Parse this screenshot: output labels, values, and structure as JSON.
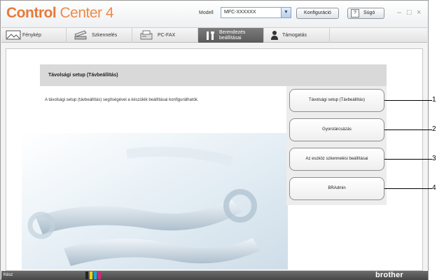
{
  "window": {
    "title_part1": "Control",
    "title_part2": "Center 4",
    "model_label": "Modell",
    "model_value": "MFC-XXXXXX",
    "config_label": "Konfiguráció",
    "help_label": "Súgó",
    "help_icon": "?",
    "controls": {
      "minimize": "–",
      "maximize": "□",
      "close": "×"
    }
  },
  "tabs": [
    {
      "label": "Fénykép",
      "icon": "photo-icon"
    },
    {
      "label": "Szkennelés",
      "icon": "scanner-icon"
    },
    {
      "label": "PC-FAX",
      "icon": "fax-icon"
    },
    {
      "label_line1": "Berendezés",
      "label_line2": "beállításai",
      "icon": "tools-icon",
      "active": true
    },
    {
      "label": "Támogatás",
      "icon": "support-person-icon"
    }
  ],
  "main": {
    "section_title": "Távolsági setup (Távbeállítás)",
    "description": "A távolsági setup (távbeállítás) segítségével a készülék beállításai konfigurálhatók.",
    "buttons": [
      "Távolsági setup (Távbeállítás)",
      "Gyorstárcsázás",
      "Az eszköz szkennelési beállításai",
      "BRAdmin"
    ]
  },
  "callouts": [
    "1",
    "2",
    "3",
    "4"
  ],
  "status": {
    "text": "Kész",
    "ink_colors": [
      "#222222",
      "#e8d21c",
      "#1aa3d9",
      "#d1287a"
    ],
    "brand": "brother"
  },
  "colors": {
    "title_accent": "#e8793a",
    "active_tab": "#6b6b6b",
    "status_bar": "#555555"
  }
}
